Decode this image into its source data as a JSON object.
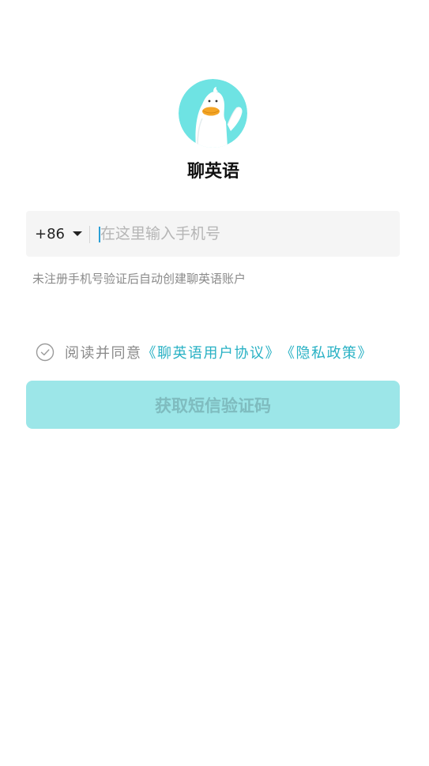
{
  "app": {
    "name": "聊英语",
    "logo_icon": "duck-mascot-icon",
    "logo_bg_color": "#6ee3e3"
  },
  "login": {
    "country_code": "+86",
    "phone_placeholder": "在这里输入手机号",
    "phone_value": "",
    "hint": "未注册手机号验证后自动创建聊英语账户",
    "agree_prefix": "阅读并同意",
    "user_agreement_link": "《聊英语用户协议》",
    "privacy_policy_link": "《隐私政策》",
    "agree_checked": false,
    "submit_label": "获取短信验证码",
    "accent_color": "#28b1c4",
    "button_color": "#9ce6e8"
  }
}
